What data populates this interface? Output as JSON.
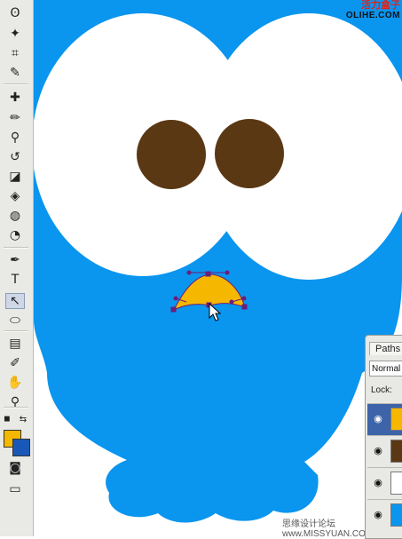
{
  "toolbox": {
    "tools": [
      {
        "name": "lasso-tool",
        "glyph": "ʘ"
      },
      {
        "name": "magic-wand-tool",
        "glyph": "✦"
      },
      {
        "name": "crop-tool",
        "glyph": "⌗"
      },
      {
        "name": "slice-tool",
        "glyph": "✎"
      },
      {
        "name": "healing-brush-tool",
        "glyph": "✚"
      },
      {
        "name": "brush-tool",
        "glyph": "✏"
      },
      {
        "name": "clone-stamp-tool",
        "glyph": "⚲"
      },
      {
        "name": "history-brush-tool",
        "glyph": "↺"
      },
      {
        "name": "eraser-tool",
        "glyph": "◪"
      },
      {
        "name": "paint-bucket-tool",
        "glyph": "◈"
      },
      {
        "name": "blur-tool",
        "glyph": "◍"
      },
      {
        "name": "dodge-tool",
        "glyph": "◔"
      },
      {
        "name": "pen-tool",
        "glyph": "✒"
      },
      {
        "name": "type-tool",
        "glyph": "T"
      },
      {
        "name": "direct-selection-tool",
        "glyph": "↖"
      },
      {
        "name": "ellipse-tool",
        "glyph": "⬭"
      },
      {
        "name": "notes-tool",
        "glyph": "▤"
      },
      {
        "name": "eyedropper-tool",
        "glyph": "✐"
      },
      {
        "name": "hand-tool",
        "glyph": "✋"
      },
      {
        "name": "zoom-tool",
        "glyph": "⚲"
      }
    ],
    "active_tool": "direct-selection-tool",
    "foreground_color": "#f4b800",
    "background_color": "#1a58b8",
    "quick_mask_icon": "quick-mask-icon",
    "screen_mode_icon": "screen-mode-icon"
  },
  "canvas": {
    "body_color": "#0a95ee",
    "eye_white_color": "#ffffff",
    "pupil_color": "#5a3814",
    "beak_color": "#f5b700",
    "path_color": "#6b1e78"
  },
  "watermarks": {
    "top_cn": "活力盒子",
    "top_en": "OLIHE.COM",
    "bottom": "思缘设计论坛 www.MISSYUAN.COM"
  },
  "paths_panel": {
    "tab_label": "Paths",
    "blend_mode": "Normal",
    "lock_label": "Lock:",
    "layers": [
      {
        "thumb_color": "#f5b700",
        "selected": true
      },
      {
        "thumb_color": "#5a3814",
        "selected": false
      },
      {
        "thumb_color": "#ffffff",
        "selected": false
      },
      {
        "thumb_color": "#0a95ee",
        "selected": false
      }
    ]
  }
}
